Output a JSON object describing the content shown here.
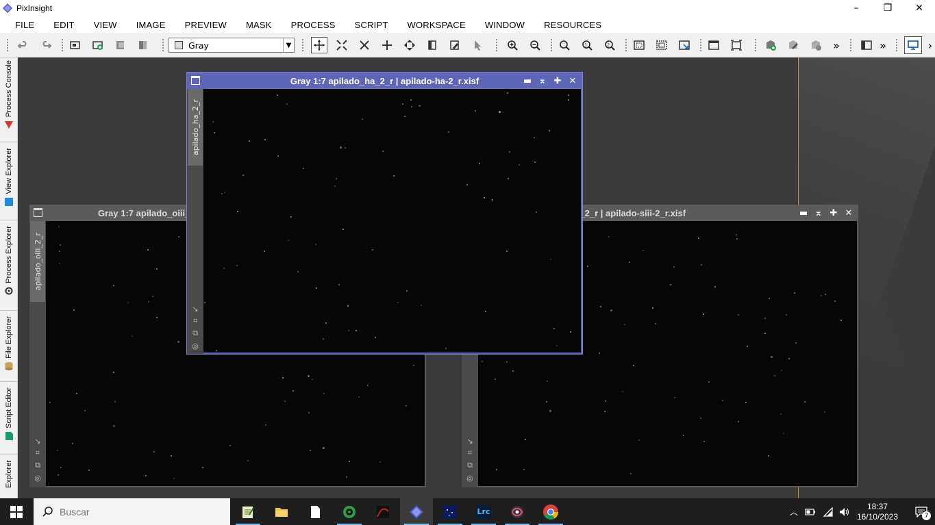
{
  "window": {
    "title": "PixInsight",
    "minimize": "–",
    "maximize": "❐",
    "close": "✕"
  },
  "menu": [
    "FILE",
    "EDIT",
    "VIEW",
    "IMAGE",
    "PREVIEW",
    "MASK",
    "PROCESS",
    "SCRIPT",
    "WORKSPACE",
    "WINDOW",
    "RESOURCES"
  ],
  "toolbar": {
    "colorspace_select": "Gray",
    "more1": "»",
    "more2": "»",
    "more3": "›"
  },
  "sidedock": [
    "Process Console",
    "View Explorer",
    "Process Explorer",
    "File Explorer",
    "Script Editor",
    "Explorer"
  ],
  "image_windows": [
    {
      "title": "Gray 1:7 apilado_oiii_2_r | apilado-oiii-2_r.xisf",
      "id": "apilado_oiii_2_r"
    },
    {
      "title": "Gray 1:7 apilado_siii_2_r | apilado-siii-2_r.xisf",
      "id": "apilado_siii_2_r"
    },
    {
      "title": "Gray 1:7 apilado_ha_2_r | apilado-ha-2_r.xisf",
      "id": "apilado_ha_2_r"
    }
  ],
  "window_buttons": {
    "minimize": "▬",
    "shade": "⌅",
    "maximize": "✚",
    "close": "✕"
  },
  "taskbar": {
    "search_placeholder": "Buscar",
    "time": "18:37",
    "date": "16/10/2023",
    "notifications": "7",
    "apps": [
      "notepad-icon",
      "folder-icon",
      "document-icon",
      "green-circle-icon",
      "red-wave-icon",
      "pixinsight-icon",
      "stars-icon",
      "lightroom-icon",
      "galaxy-icon",
      "chrome-icon"
    ],
    "lrc_label": "Lrc"
  },
  "colors": {
    "active_window": "#5e66b8",
    "inactive_window": "#5b5b5b",
    "workspace": "#3b3b3b",
    "accent_line": "#c98a48"
  }
}
